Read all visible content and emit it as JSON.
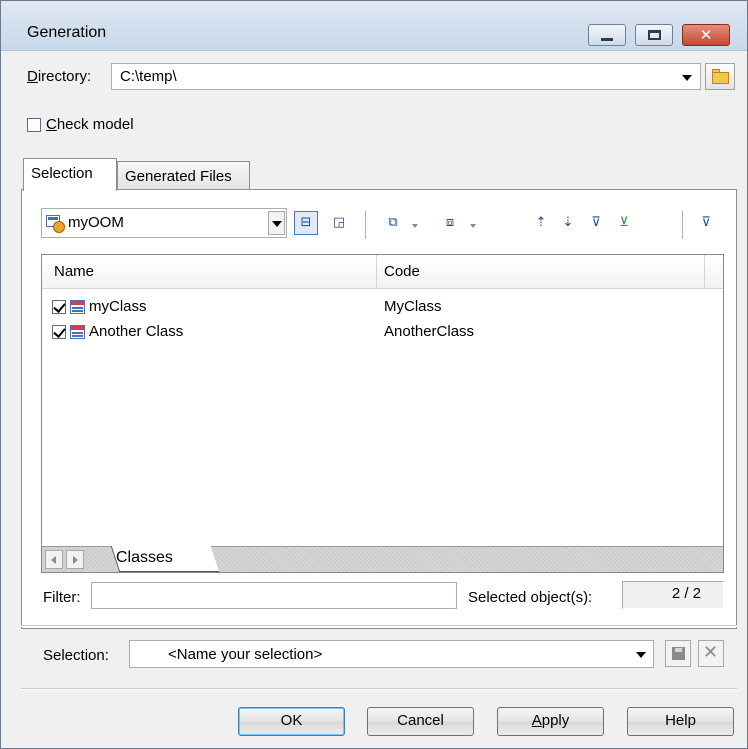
{
  "window": {
    "title": "Generation"
  },
  "directory": {
    "label_prefix": "D",
    "label_rest": "irectory:",
    "value": "C:\\temp\\"
  },
  "check_model": {
    "label_prefix": "C",
    "label_rest": "heck model",
    "checked": false
  },
  "tabs": [
    {
      "label": "Selection",
      "active": true
    },
    {
      "label": "Generated Files",
      "active": false
    }
  ],
  "model_select": {
    "value": "myOOM"
  },
  "toolbar_icons": [
    "hierarchy-icon",
    "locate-icon",
    "select-all-icon",
    "deselect-all-icon",
    "move-up-icon",
    "move-down-icon",
    "filter-edit-icon",
    "filter-apply-icon",
    "filter-toggle-icon"
  ],
  "grid": {
    "columns": [
      "Name",
      "Code"
    ],
    "rows": [
      {
        "name": "myClass",
        "code": "MyClass",
        "checked": true
      },
      {
        "name": "Another Class",
        "code": "AnotherClass",
        "checked": true
      }
    ],
    "sheet_tab": "Classes"
  },
  "filter": {
    "label": "Filter:",
    "value": ""
  },
  "selected_objects": {
    "label": "Selected object(s):",
    "value": "2 / 2"
  },
  "selection": {
    "label": "Selection:",
    "placeholder": "<Name your selection>"
  },
  "buttons": {
    "ok": "OK",
    "cancel": "Cancel",
    "apply_prefix": "A",
    "apply_rest": "pply",
    "help": "Help"
  }
}
